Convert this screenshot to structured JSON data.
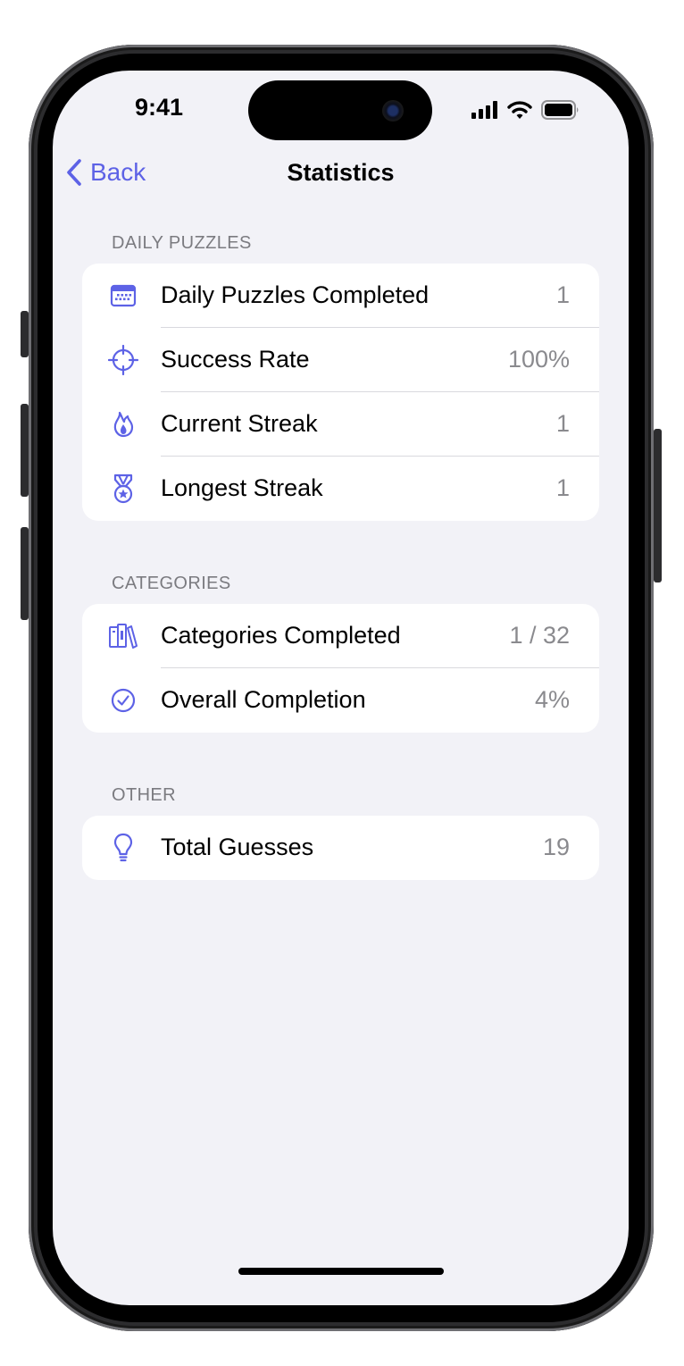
{
  "status_bar": {
    "time": "9:41"
  },
  "nav": {
    "back_label": "Back",
    "title": "Statistics"
  },
  "sections": [
    {
      "header": "DAILY PUZZLES",
      "rows": [
        {
          "icon": "calendar-icon",
          "label": "Daily Puzzles Completed",
          "value": "1"
        },
        {
          "icon": "crosshair-icon",
          "label": "Success Rate",
          "value": "100%"
        },
        {
          "icon": "flame-icon",
          "label": "Current Streak",
          "value": "1"
        },
        {
          "icon": "medal-icon",
          "label": "Longest Streak",
          "value": "1"
        }
      ]
    },
    {
      "header": "CATEGORIES",
      "rows": [
        {
          "icon": "books-icon",
          "label": "Categories Completed",
          "value": "1 / 32"
        },
        {
          "icon": "checkmark-circle-icon",
          "label": "Overall Completion",
          "value": "4%"
        }
      ]
    },
    {
      "header": "OTHER",
      "rows": [
        {
          "icon": "lightbulb-icon",
          "label": "Total Guesses",
          "value": "19"
        }
      ]
    }
  ],
  "colors": {
    "accent": "#5d62e6",
    "background": "#f2f2f7",
    "card": "#ffffff",
    "secondary_text": "#8a8a8e"
  }
}
